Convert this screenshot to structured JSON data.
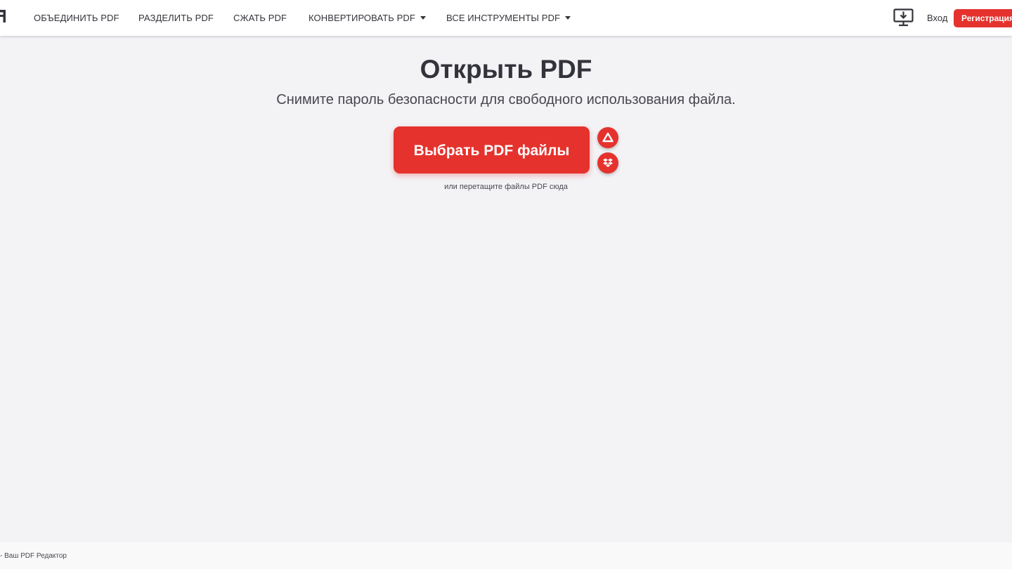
{
  "header": {
    "logo_icon": "logo-icon",
    "nav": [
      {
        "label": "ОБЪЕДИНИТЬ PDF",
        "dropdown": false
      },
      {
        "label": "РАЗДЕЛИТЬ PDF",
        "dropdown": false
      },
      {
        "label": "СЖАТЬ PDF",
        "dropdown": false
      },
      {
        "label": "КОНВЕРТИРОВАТЬ PDF",
        "dropdown": true
      },
      {
        "label": "ВСЕ ИНСТРУМЕНТЫ PDF",
        "dropdown": true
      }
    ],
    "desktop_icon": "desktop-download-icon",
    "login_label": "Вход",
    "signup_label": "Регистрация"
  },
  "main": {
    "title": "Открыть PDF",
    "subtitle": "Снимите пароль безопасности для свободного использования файла.",
    "select_button_label": "Выбрать PDF файлы",
    "cloud_icons": [
      "google-drive-icon",
      "dropbox-icon"
    ],
    "drop_hint": "или перетащите файлы PDF сюда"
  },
  "footer": {
    "text": "- Ваш PDF Редактор"
  },
  "colors": {
    "accent": "#e5322d",
    "text": "#33333b",
    "background": "#f3f3f6",
    "header_background": "#ffffff"
  }
}
